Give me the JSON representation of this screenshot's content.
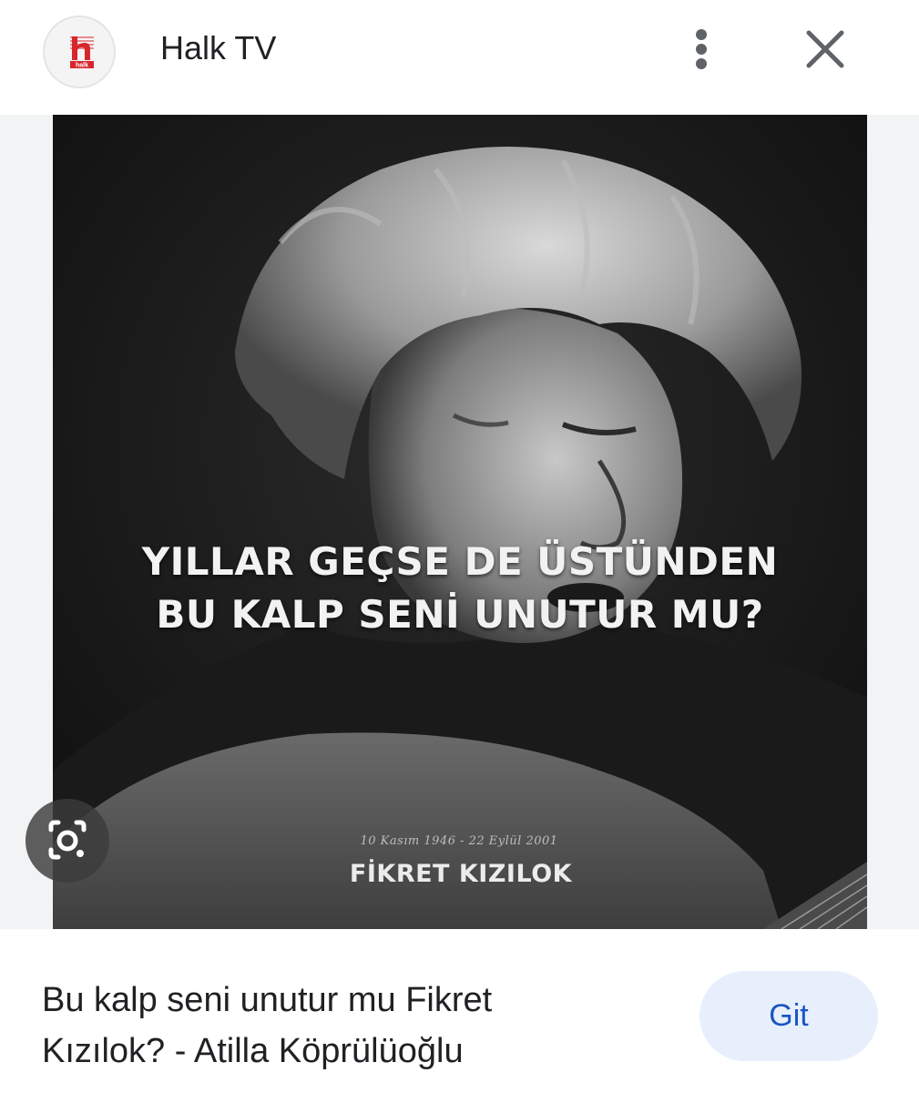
{
  "header": {
    "logo_text": "halk",
    "source_name": "Halk TV",
    "more_icon": "more-vert-icon",
    "close_icon": "close-icon"
  },
  "image": {
    "quote_line_1": "YILLAR GEÇSE DE ÜSTÜNDEN",
    "quote_line_2": "BU KALP SENİ UNUTUR MU?",
    "dates": "10 Kasım 1946 - 22 Eylül 2001",
    "artist_name": "FİKRET KIZILOK"
  },
  "lens": {
    "icon": "lens-search-icon"
  },
  "footer": {
    "caption_line_1": "Bu kalp seni unutur mu Fikret",
    "caption_line_2": "Kızılok? - Atilla Köprülüoğlu",
    "visit_label": "Git"
  },
  "colors": {
    "logo_red": "#d7262c",
    "button_bg": "#e8effc",
    "button_text": "#1a56c4"
  }
}
